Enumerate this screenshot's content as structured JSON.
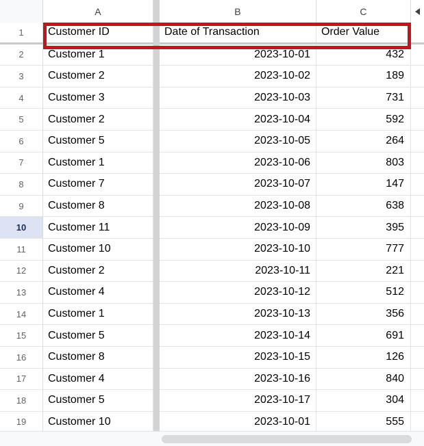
{
  "spreadsheet": {
    "columns": [
      {
        "letter": "A"
      },
      {
        "letter": "B"
      },
      {
        "letter": "C"
      }
    ],
    "collapse_arrow_icon": "triangle-left-icon",
    "header_row": {
      "row_number": "1",
      "cells": [
        "Customer ID",
        "Date of Transaction",
        "Order Value"
      ]
    },
    "selected_row_number": "10",
    "selection_border_color": "#c0161d",
    "selected_row_header_bg": "#dde3f3",
    "rows": [
      {
        "n": "2",
        "a": "Customer 1",
        "b": "2023-10-01",
        "c": "432"
      },
      {
        "n": "3",
        "a": "Customer 2",
        "b": "2023-10-02",
        "c": "189"
      },
      {
        "n": "4",
        "a": "Customer 3",
        "b": "2023-10-03",
        "c": "731"
      },
      {
        "n": "5",
        "a": "Customer 2",
        "b": "2023-10-04",
        "c": "592"
      },
      {
        "n": "6",
        "a": "Customer 5",
        "b": "2023-10-05",
        "c": "264"
      },
      {
        "n": "7",
        "a": "Customer 1",
        "b": "2023-10-06",
        "c": "803"
      },
      {
        "n": "8",
        "a": "Customer 7",
        "b": "2023-10-07",
        "c": "147"
      },
      {
        "n": "9",
        "a": "Customer 8",
        "b": "2023-10-08",
        "c": "638"
      },
      {
        "n": "10",
        "a": "Customer 11",
        "b": "2023-10-09",
        "c": "395"
      },
      {
        "n": "11",
        "a": "Customer 10",
        "b": "2023-10-10",
        "c": "777"
      },
      {
        "n": "12",
        "a": "Customer 2",
        "b": "2023-10-11",
        "c": "221"
      },
      {
        "n": "13",
        "a": "Customer 4",
        "b": "2023-10-12",
        "c": "512"
      },
      {
        "n": "14",
        "a": "Customer 1",
        "b": "2023-10-13",
        "c": "356"
      },
      {
        "n": "15",
        "a": "Customer 5",
        "b": "2023-10-14",
        "c": "691"
      },
      {
        "n": "16",
        "a": "Customer 8",
        "b": "2023-10-15",
        "c": "126"
      },
      {
        "n": "17",
        "a": "Customer 4",
        "b": "2023-10-16",
        "c": "840"
      },
      {
        "n": "18",
        "a": "Customer 5",
        "b": "2023-10-17",
        "c": "304"
      },
      {
        "n": "19",
        "a": "Customer 10",
        "b": "2023-10-01",
        "c": "555"
      }
    ]
  }
}
